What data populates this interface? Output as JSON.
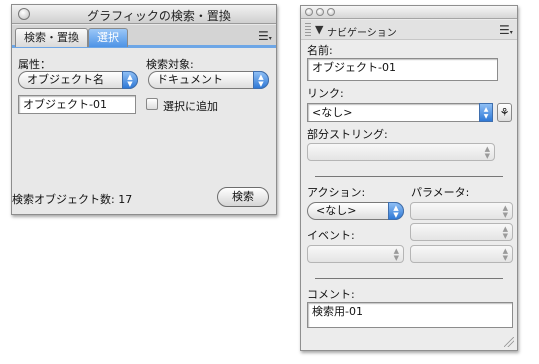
{
  "find_replace": {
    "title": "グラフィックの検索・置換",
    "tabs": [
      {
        "label": "検索・置換",
        "active": false
      },
      {
        "label": "選択",
        "active": true
      }
    ],
    "attribute_label": "属性：",
    "attribute_value": "オブジェクト名",
    "search_target_label": "検索対象:",
    "search_target_value": "ドキュメント",
    "name_value": "オブジェクト-01",
    "add_to_selection_label": "選択に追加",
    "count_label": "検索オブジェクト数: 17",
    "search_button": "検索"
  },
  "navigation": {
    "title": "ナビゲーション",
    "name_label": "名前:",
    "name_value": "オブジェクト-01",
    "link_label": "リンク:",
    "link_value": "<なし>",
    "substring_label": "部分ストリング:",
    "action_label": "アクション:",
    "action_value": "<なし>",
    "parameter_label": "パラメータ:",
    "event_label": "イベント:",
    "comment_label": "コメント:",
    "comment_value": "検索用-01"
  },
  "colors": {
    "accent_blue": "#4d93e6",
    "panel_bg": "#e8e8e8"
  }
}
